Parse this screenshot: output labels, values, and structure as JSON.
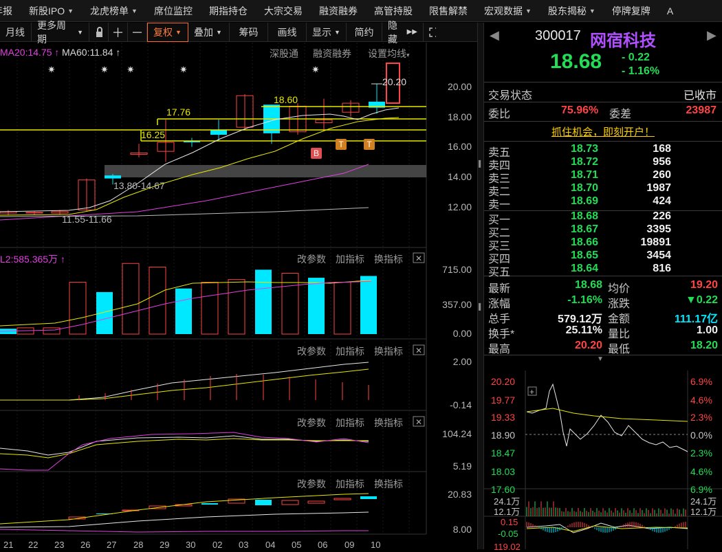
{
  "menu": [
    {
      "label": "年报",
      "caret": false
    },
    {
      "label": "新股IPO",
      "caret": true
    },
    {
      "label": "龙虎榜单",
      "caret": true
    },
    {
      "label": "席位监控",
      "caret": false
    },
    {
      "label": "期指持仓",
      "caret": false
    },
    {
      "label": "大宗交易",
      "caret": false
    },
    {
      "label": "融资融券",
      "caret": false
    },
    {
      "label": "高管持股",
      "caret": false
    },
    {
      "label": "限售解禁",
      "caret": false
    },
    {
      "label": "宏观数据",
      "caret": true
    },
    {
      "label": "股东揭秘",
      "caret": true
    },
    {
      "label": "停牌复牌",
      "caret": false
    },
    {
      "label": "A",
      "caret": false
    }
  ],
  "toolbar": {
    "period": "月线",
    "more_period": "更多周期",
    "fuquan": "复权",
    "overlay": "叠加",
    "chips": "筹码",
    "draw": "画线",
    "display": "显示",
    "simple": "简约",
    "hide": "隐藏"
  },
  "kline": {
    "ma20": "MA20:14.75",
    "ma60": "MA60:11.84",
    "links": [
      "深股通",
      "融资融券",
      "设置均线"
    ],
    "price_labels": {
      "high_marker": "20.20",
      "l1": "18.60",
      "l2": "17.76",
      "l3": "16.25",
      "range1": "13.80-14.67",
      "range2": "11.55-11.66"
    },
    "axis": [
      "20.00",
      "18.00",
      "16.00",
      "14.00",
      "12.00"
    ],
    "signal_b": "B",
    "signal_t": "T"
  },
  "vol": {
    "title": "L2:585.365万",
    "links": [
      "改参数",
      "加指标",
      "换指标"
    ],
    "axis": [
      "715.00",
      "357.00",
      "0.00"
    ]
  },
  "macd": {
    "links": [
      "改参数",
      "加指标",
      "换指标"
    ],
    "axis": [
      "2.00",
      "-0.14"
    ]
  },
  "kdj": {
    "links": [
      "改参数",
      "加指标",
      "换指标"
    ],
    "axis": [
      "104.24",
      "5.19"
    ]
  },
  "p5": {
    "links": [
      "改参数",
      "加指标",
      "换指标"
    ],
    "axis": [
      "20.83",
      "8.00"
    ]
  },
  "xaxis": [
    "21",
    "22",
    "23",
    "26",
    "27",
    "28",
    "29",
    "30",
    "02",
    "03",
    "04",
    "05",
    "06",
    "09",
    "10"
  ],
  "quote": {
    "code": "300017",
    "name": "网宿科技",
    "price": "18.68",
    "change": "- 0.22",
    "pct": "- 1.16%",
    "status_label": "交易状态",
    "status_value": "已收市",
    "weibi_label": "委比",
    "weibi": "75.96%",
    "weicha_label": "委差",
    "weicha": "23987",
    "promo": "抓住机会，即刻开户！",
    "asks": [
      {
        "label": "卖五",
        "price": "18.73",
        "vol": "168"
      },
      {
        "label": "卖四",
        "price": "18.72",
        "vol": "956"
      },
      {
        "label": "卖三",
        "price": "18.71",
        "vol": "260"
      },
      {
        "label": "卖二",
        "price": "18.70",
        "vol": "1987"
      },
      {
        "label": "卖一",
        "price": "18.69",
        "vol": "424"
      }
    ],
    "bids": [
      {
        "label": "买一",
        "price": "18.68",
        "vol": "226"
      },
      {
        "label": "买二",
        "price": "18.67",
        "vol": "3395"
      },
      {
        "label": "买三",
        "price": "18.66",
        "vol": "19891"
      },
      {
        "label": "买四",
        "price": "18.65",
        "vol": "3454"
      },
      {
        "label": "买五",
        "price": "18.64",
        "vol": "816"
      }
    ],
    "stats": [
      {
        "l1": "最新",
        "v1": "18.68",
        "c1": "green",
        "l2": "均价",
        "v2": "19.20",
        "c2": "red"
      },
      {
        "l1": "涨幅",
        "v1": "-1.16%",
        "c1": "green",
        "l2": "涨跌",
        "v2": "▼0.22",
        "c2": "green"
      },
      {
        "l1": "总手",
        "v1": "579.12万",
        "c1": "white",
        "l2": "金额",
        "v2": "111.17亿",
        "c2": "cyan"
      },
      {
        "l1": "换手*",
        "v1": "25.11%",
        "c1": "white",
        "l2": "量比",
        "v2": "1.00",
        "c2": "white"
      },
      {
        "l1": "最高",
        "v1": "20.20",
        "c1": "red",
        "l2": "最低",
        "v2": "18.20",
        "c2": "green"
      }
    ]
  },
  "mini": {
    "left_axis": [
      "20.20",
      "19.77",
      "19.33",
      "18.90",
      "18.47",
      "18.03",
      "17.60"
    ],
    "right_axis": [
      "6.9%",
      "4.6%",
      "2.3%",
      "0.0%",
      "2.3%",
      "4.6%",
      "6.9%"
    ],
    "vol_left": [
      "24.1万",
      "12.1万"
    ],
    "vol_right": [
      "24.1万",
      "12.1万"
    ],
    "macd_left": [
      "0.15",
      "-0.05",
      "119.02"
    ]
  },
  "colors": {
    "up": "#ff4444",
    "down": "#00e8ff",
    "ma_white": "#e8e8e8",
    "ma_yellow": "#e8e800",
    "ma_magenta": "#e040e0"
  }
}
